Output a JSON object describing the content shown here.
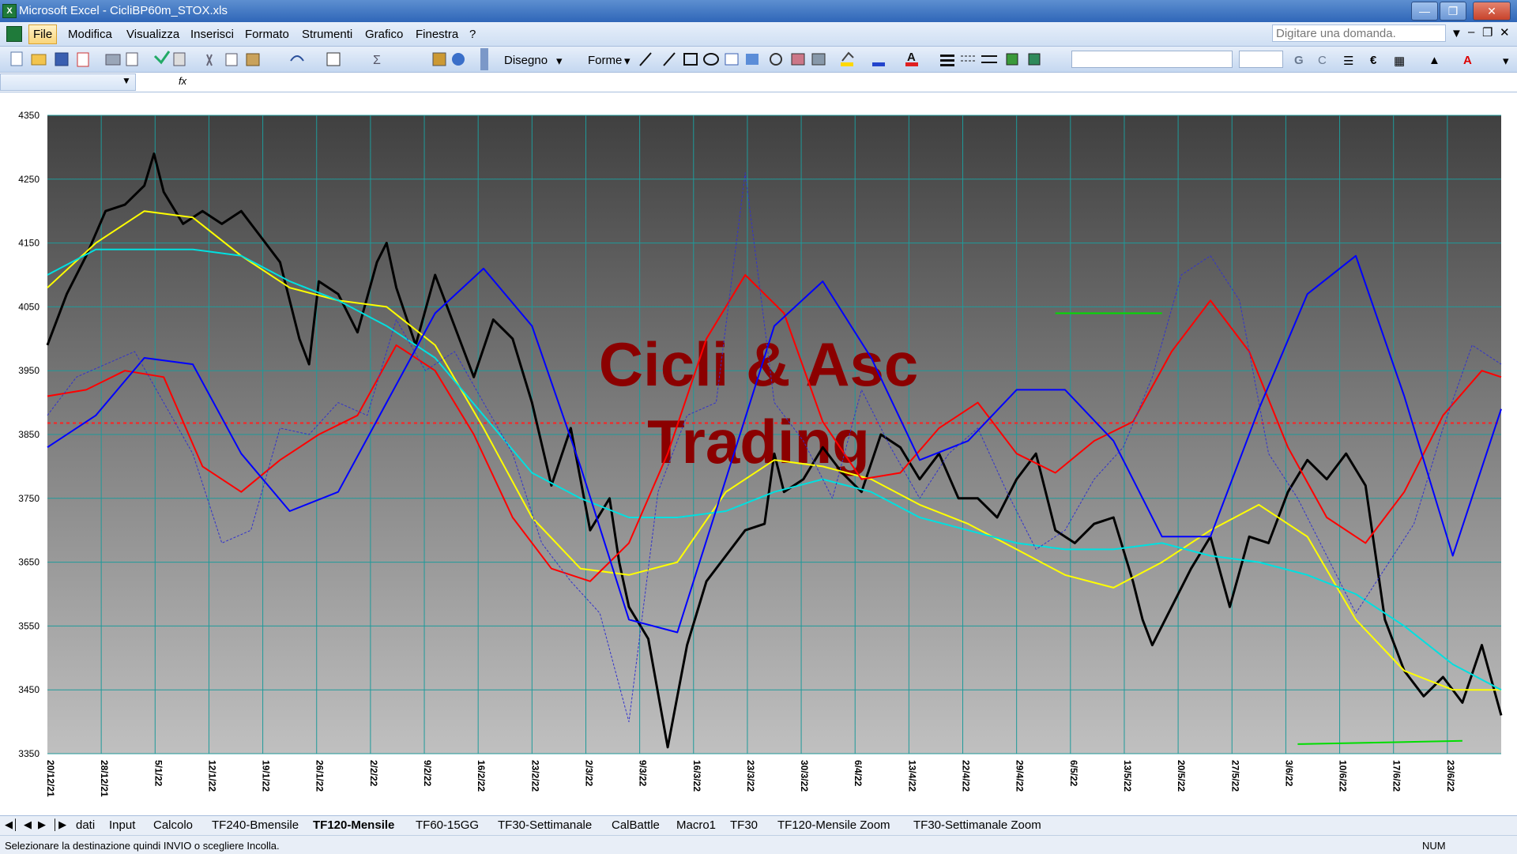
{
  "window": {
    "title": "Microsoft Excel - CicliBP60m_STOX.xls"
  },
  "menu": {
    "items": [
      "File",
      "Modifica",
      "Visualizza",
      "Inserisci",
      "Formato",
      "Strumenti",
      "Grafico",
      "Finestra",
      "?"
    ],
    "question_placeholder": "Digitare una domanda."
  },
  "toolbar": {
    "draw_label": "Disegno",
    "shapes_label": "Forme",
    "bold": "G",
    "italic": "C",
    "euro": "€"
  },
  "sheet_tabs": [
    "dati",
    "Input",
    "Calcolo",
    "TF240-Bmensile",
    "TF120-Mensile",
    "TF60-15GG",
    "TF30-Settimanale",
    "CalBattle",
    "Macro1",
    "TF30",
    "TF120-Mensile Zoom",
    "TF30-Settimanale Zoom"
  ],
  "active_tab_index": 4,
  "status": {
    "message": "Selezionare la destinazione quindi INVIO o scegliere Incolla.",
    "num": "NUM"
  },
  "chart_data": {
    "type": "line",
    "watermark": [
      "Cicli & Asc",
      "Trading"
    ],
    "ylim": [
      3350,
      4350
    ],
    "yticks": [
      3350,
      3450,
      3550,
      3650,
      3750,
      3850,
      3950,
      4050,
      4150,
      4250,
      4350
    ],
    "xlim": [
      0,
      150
    ],
    "xtick_labels": [
      "20/12/21",
      "28/12/21",
      "5/1/22",
      "12/1/22",
      "19/1/22",
      "26/1/22",
      "2/2/22",
      "9/2/22",
      "16/2/22",
      "23/2/22",
      "2/3/22",
      "9/3/22",
      "16/3/22",
      "23/3/22",
      "30/3/22",
      "6/4/22",
      "13/4/22",
      "22/4/22",
      "29/4/22",
      "6/5/22",
      "13/5/22",
      "20/5/22",
      "27/5/22",
      "3/6/22",
      "10/6/22",
      "17/6/22",
      "23/6/22"
    ],
    "reference_line": 3868,
    "grid": true,
    "legend": "none",
    "series": [
      {
        "color": "#000000",
        "width": 3,
        "style": "solid",
        "x": [
          0,
          2,
          4,
          6,
          8,
          10,
          11,
          12,
          14,
          16,
          18,
          20,
          22,
          24,
          26,
          27,
          28,
          30,
          32,
          34,
          35,
          36,
          38,
          40,
          42,
          44,
          46,
          48,
          50,
          52,
          54,
          56,
          58,
          59,
          60,
          62,
          64,
          65,
          66,
          68,
          70,
          72,
          74,
          75,
          76,
          78,
          80,
          82,
          84,
          86,
          88,
          90,
          92,
          94,
          96,
          98,
          100,
          102,
          104,
          106,
          108,
          110,
          112,
          113,
          114,
          116,
          118,
          120,
          122,
          124,
          126,
          128,
          130,
          132,
          134,
          136,
          138,
          140,
          142,
          144,
          146,
          148,
          150
        ],
        "y": [
          3990,
          4070,
          4130,
          4200,
          4210,
          4240,
          4290,
          4230,
          4180,
          4200,
          4180,
          4200,
          4160,
          4120,
          4000,
          3960,
          4090,
          4070,
          4010,
          4120,
          4150,
          4080,
          3990,
          4100,
          4020,
          3940,
          4030,
          4000,
          3900,
          3770,
          3860,
          3700,
          3750,
          3650,
          3580,
          3530,
          3360,
          3440,
          3520,
          3620,
          3660,
          3700,
          3710,
          3820,
          3760,
          3780,
          3830,
          3790,
          3760,
          3850,
          3830,
          3780,
          3820,
          3750,
          3750,
          3720,
          3780,
          3820,
          3700,
          3680,
          3710,
          3720,
          3620,
          3560,
          3520,
          3580,
          3640,
          3690,
          3580,
          3690,
          3680,
          3760,
          3810,
          3780,
          3820,
          3770,
          3560,
          3480,
          3440,
          3470,
          3430,
          3520,
          3410
        ]
      },
      {
        "color": "#ffff00",
        "width": 2,
        "style": "solid",
        "x": [
          0,
          5,
          10,
          15,
          20,
          25,
          30,
          35,
          40,
          45,
          50,
          55,
          60,
          65,
          70,
          75,
          80,
          85,
          90,
          95,
          100,
          105,
          110,
          115,
          120,
          125,
          130,
          135,
          140,
          145,
          150
        ],
        "y": [
          4080,
          4150,
          4200,
          4190,
          4130,
          4080,
          4060,
          4050,
          3990,
          3860,
          3720,
          3640,
          3630,
          3650,
          3760,
          3810,
          3800,
          3780,
          3740,
          3710,
          3670,
          3630,
          3610,
          3650,
          3700,
          3740,
          3690,
          3560,
          3480,
          3450,
          3450
        ]
      },
      {
        "color": "#00e0e0",
        "width": 2,
        "style": "solid",
        "x": [
          0,
          5,
          10,
          15,
          20,
          25,
          30,
          35,
          40,
          45,
          50,
          55,
          60,
          65,
          70,
          75,
          80,
          85,
          90,
          95,
          100,
          105,
          110,
          115,
          120,
          125,
          130,
          135,
          140,
          145,
          150
        ],
        "y": [
          4100,
          4140,
          4140,
          4140,
          4130,
          4090,
          4060,
          4020,
          3970,
          3880,
          3790,
          3750,
          3720,
          3720,
          3730,
          3760,
          3780,
          3760,
          3720,
          3700,
          3680,
          3670,
          3670,
          3680,
          3660,
          3650,
          3630,
          3600,
          3550,
          3490,
          3450
        ]
      },
      {
        "color": "#ff0000",
        "width": 2,
        "style": "solid",
        "x": [
          0,
          4,
          8,
          12,
          16,
          20,
          24,
          28,
          32,
          36,
          40,
          44,
          48,
          52,
          56,
          60,
          64,
          68,
          72,
          76,
          80,
          84,
          88,
          92,
          96,
          100,
          104,
          108,
          112,
          116,
          120,
          124,
          128,
          132,
          136,
          140,
          144,
          148,
          150
        ],
        "y": [
          3910,
          3920,
          3950,
          3940,
          3800,
          3760,
          3810,
          3850,
          3880,
          3990,
          3950,
          3850,
          3720,
          3640,
          3620,
          3680,
          3820,
          4000,
          4100,
          4040,
          3870,
          3780,
          3790,
          3860,
          3900,
          3820,
          3790,
          3840,
          3870,
          3980,
          4060,
          3980,
          3830,
          3720,
          3680,
          3760,
          3880,
          3950,
          3940
        ]
      },
      {
        "color": "#0000ff",
        "width": 2,
        "style": "solid",
        "x": [
          0,
          5,
          10,
          15,
          20,
          25,
          30,
          35,
          40,
          45,
          50,
          55,
          60,
          65,
          70,
          75,
          80,
          85,
          90,
          95,
          100,
          105,
          110,
          115,
          120,
          125,
          130,
          135,
          140,
          145,
          150
        ],
        "y": [
          3830,
          3880,
          3970,
          3960,
          3820,
          3730,
          3760,
          3900,
          4040,
          4110,
          4020,
          3800,
          3560,
          3540,
          3780,
          4020,
          4090,
          3970,
          3810,
          3840,
          3920,
          3920,
          3840,
          3690,
          3690,
          3890,
          4070,
          4130,
          3910,
          3660,
          3890
        ]
      },
      {
        "color": "#3333cc",
        "width": 1,
        "style": "dashed",
        "x": [
          0,
          3,
          6,
          9,
          12,
          15,
          18,
          21,
          24,
          27,
          30,
          33,
          36,
          39,
          42,
          45,
          48,
          51,
          54,
          57,
          60,
          63,
          66,
          69,
          72,
          75,
          78,
          81,
          84,
          87,
          90,
          93,
          96,
          99,
          102,
          105,
          108,
          111,
          114,
          117,
          120,
          123,
          126,
          129,
          132,
          135,
          138,
          141,
          144,
          147,
          150
        ],
        "y": [
          3880,
          3940,
          3960,
          3980,
          3900,
          3820,
          3680,
          3700,
          3860,
          3850,
          3900,
          3880,
          4030,
          3950,
          3980,
          3900,
          3820,
          3680,
          3620,
          3570,
          3400,
          3760,
          3880,
          3900,
          4260,
          3900,
          3840,
          3750,
          3920,
          3830,
          3750,
          3820,
          3860,
          3760,
          3670,
          3700,
          3780,
          3830,
          3940,
          4100,
          4130,
          4060,
          3820,
          3750,
          3660,
          3570,
          3640,
          3710,
          3860,
          3990,
          3960
        ]
      },
      {
        "color": "#00dd00",
        "width": 2,
        "style": "solid",
        "x": [
          104,
          115
        ],
        "y": [
          4040,
          4040
        ]
      },
      {
        "color": "#00dd00",
        "width": 2,
        "style": "solid",
        "x": [
          129,
          146
        ],
        "y": [
          3365,
          3370
        ]
      }
    ]
  }
}
